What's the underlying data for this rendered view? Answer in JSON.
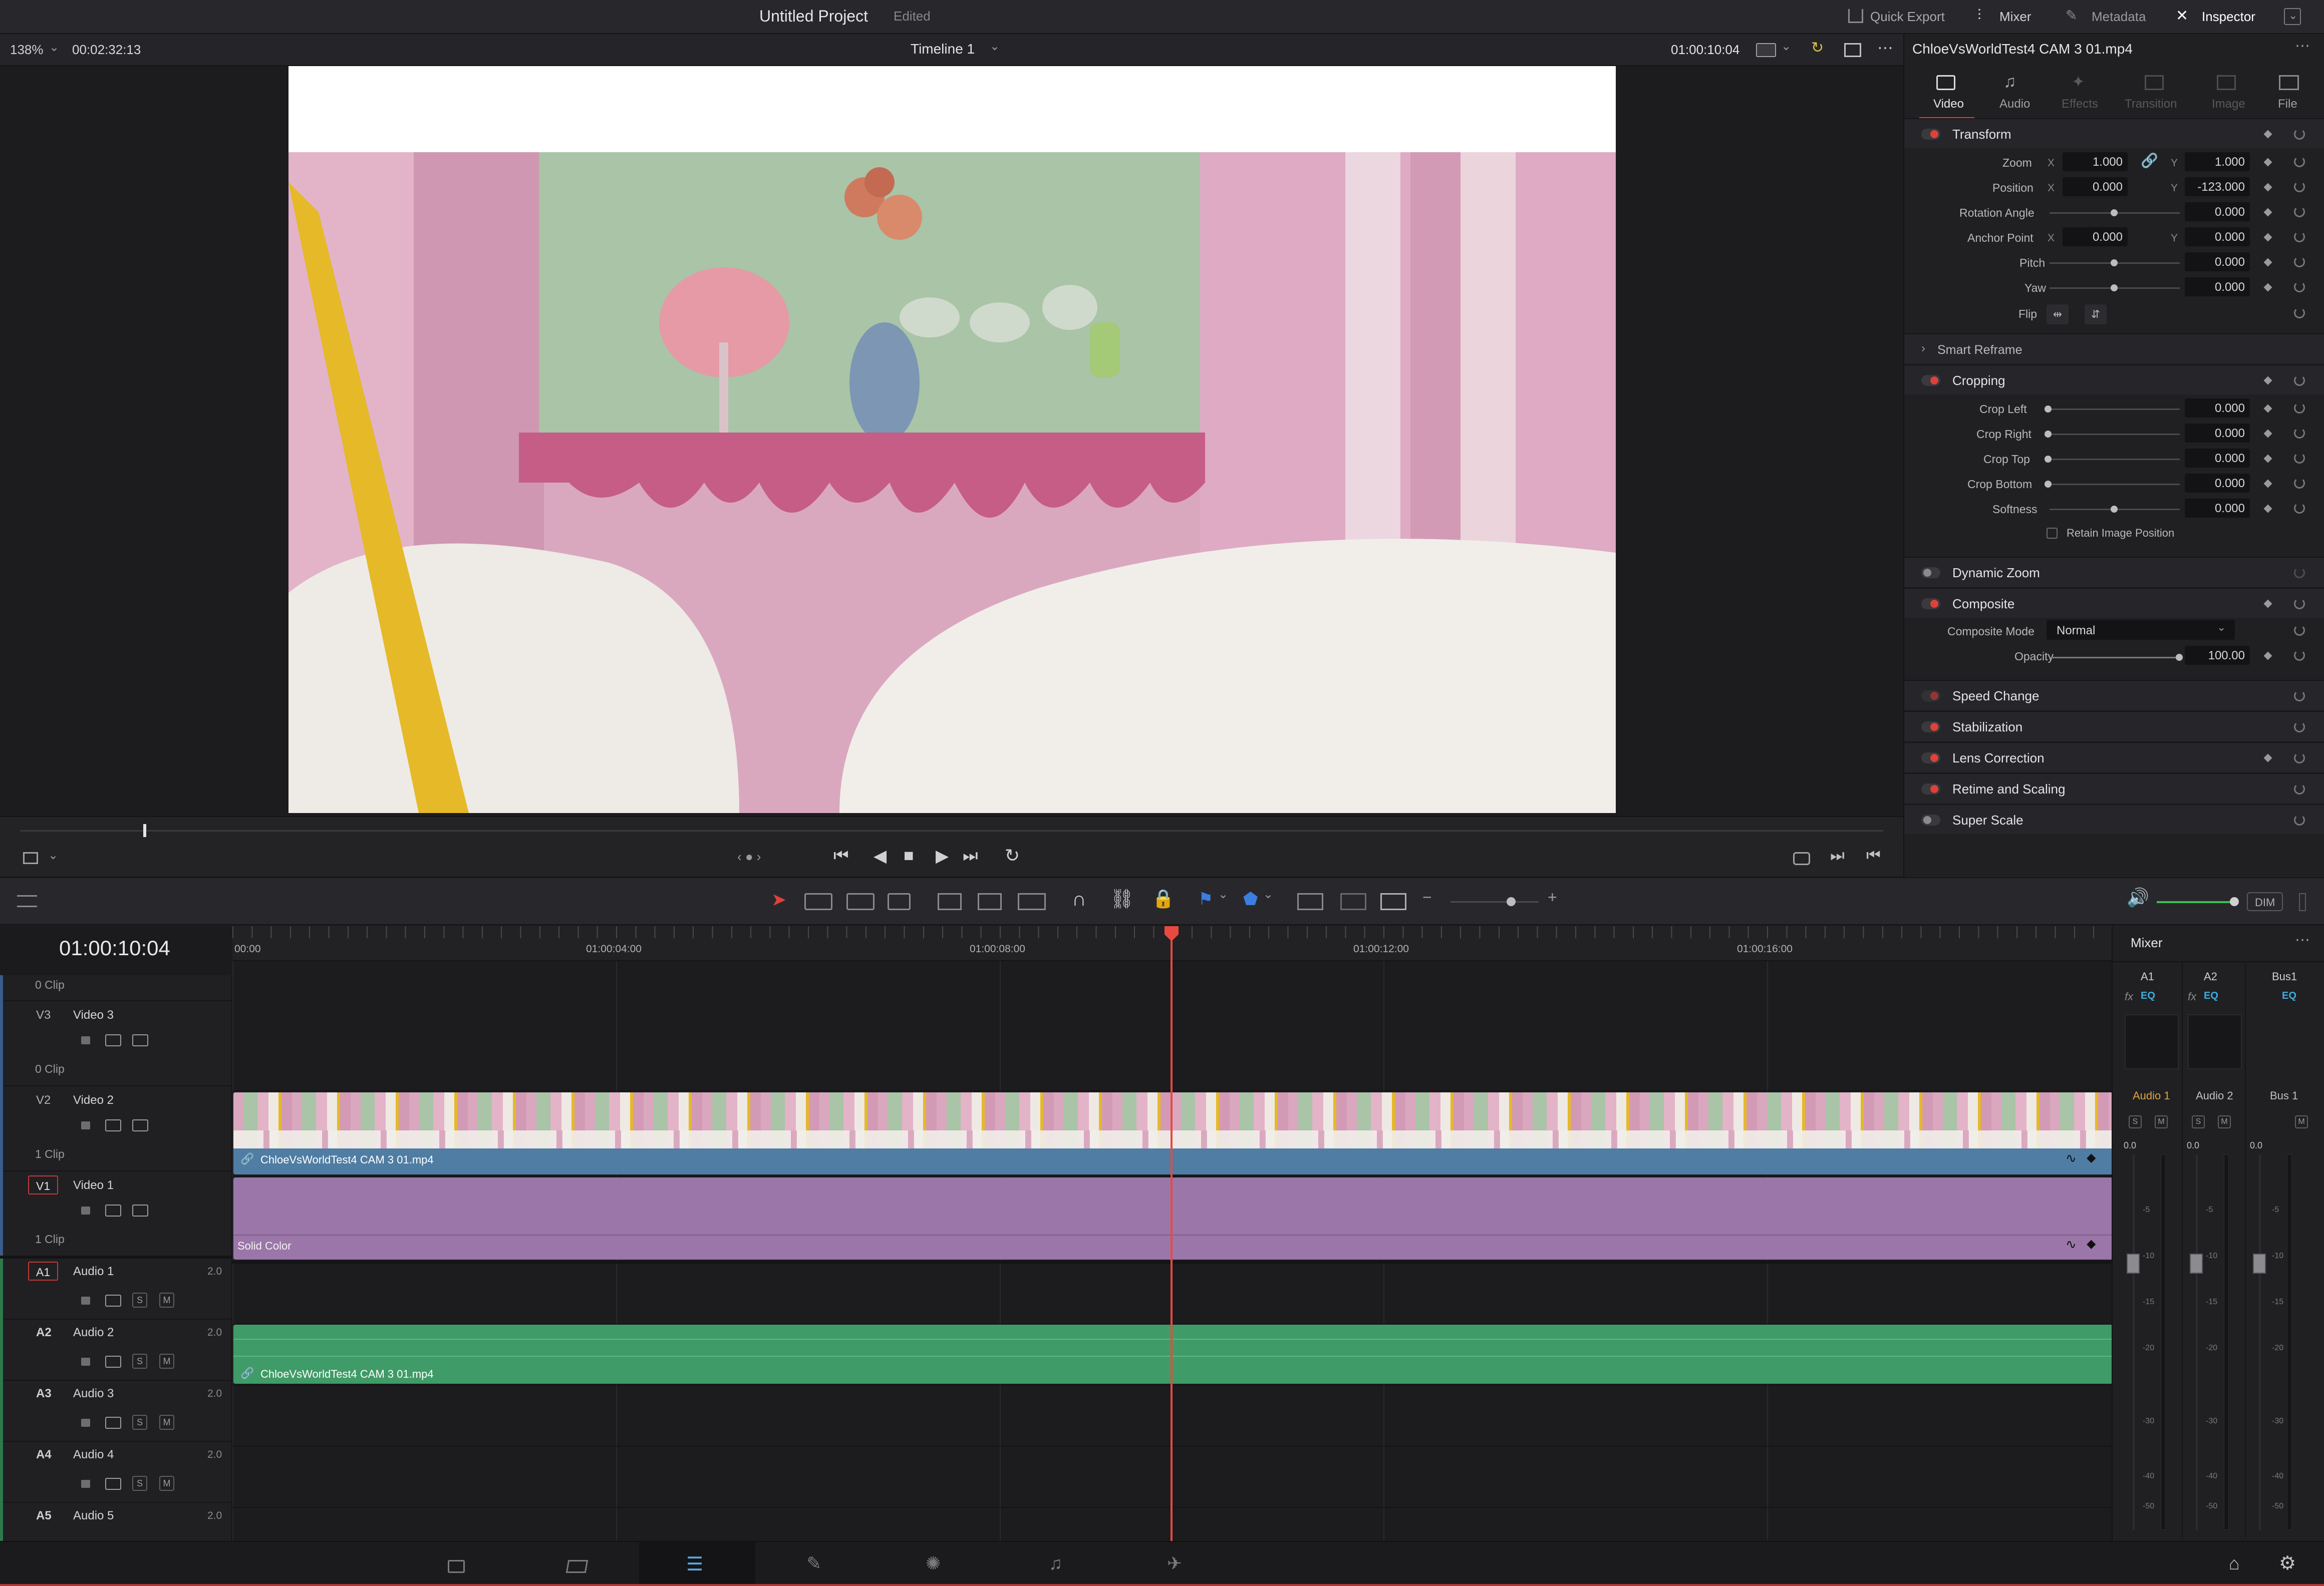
{
  "project": {
    "title": "Untitled Project",
    "status": "Edited"
  },
  "top_tabs": [
    "Quick Export",
    "Mixer",
    "Metadata",
    "Inspector"
  ],
  "viewer": {
    "zoom": "138%",
    "source_timecode": "00:02:32:13",
    "timeline_name": "Timeline 1",
    "record_timecode": "01:00:10:04"
  },
  "inspector": {
    "clip_name": "ChloeVsWorldTest4 CAM 3 01.mp4",
    "tabs": [
      "Video",
      "Audio",
      "Effects",
      "Transition",
      "Image",
      "File"
    ],
    "transform": {
      "title": "Transform",
      "zoom_label": "Zoom",
      "zoom_x": "1.000",
      "zoom_y": "1.000",
      "position_label": "Position",
      "position_x": "0.000",
      "position_y": "-123.000",
      "rotation_label": "Rotation Angle",
      "rotation": "0.000",
      "anchor_label": "Anchor Point",
      "anchor_x": "0.000",
      "anchor_y": "0.000",
      "pitch_label": "Pitch",
      "pitch": "0.000",
      "yaw_label": "Yaw",
      "yaw": "0.000",
      "flip_label": "Flip",
      "x_label": "X",
      "y_label": "Y"
    },
    "smart_reframe": "Smart Reframe",
    "cropping": {
      "title": "Cropping",
      "crop_left_label": "Crop Left",
      "crop_left": "0.000",
      "crop_right_label": "Crop Right",
      "crop_right": "0.000",
      "crop_top_label": "Crop Top",
      "crop_top": "0.000",
      "crop_bottom_label": "Crop Bottom",
      "crop_bottom": "0.000",
      "softness_label": "Softness",
      "softness": "0.000",
      "retain_label": "Retain Image Position"
    },
    "dynamic_zoom": "Dynamic Zoom",
    "composite": {
      "title": "Composite",
      "mode_label": "Composite Mode",
      "mode": "Normal",
      "opacity_label": "Opacity",
      "opacity": "100.00"
    },
    "speed_change": "Speed Change",
    "stabilization": "Stabilization",
    "lens_correction": "Lens Correction",
    "retime": "Retime and Scaling",
    "super_scale": "Super Scale"
  },
  "timeline": {
    "timecode": "01:00:10:04",
    "ruler": [
      "00:00",
      "01:00:04:00",
      "01:00:08:00",
      "01:00:12:00",
      "01:00:16:00"
    ],
    "top_clip_count": "0 Clip",
    "tracks": {
      "v3": {
        "code": "V3",
        "name": "Video 3",
        "clips": "0 Clip"
      },
      "v2": {
        "code": "V2",
        "name": "Video 2",
        "clips": "1 Clip"
      },
      "v1": {
        "code": "V1",
        "name": "Video 1",
        "clips": "1 Clip"
      },
      "a1": {
        "code": "A1",
        "name": "Audio 1",
        "ch": "2.0"
      },
      "a2": {
        "code": "A2",
        "name": "Audio 2",
        "ch": "2.0"
      },
      "a3": {
        "code": "A3",
        "name": "Audio 3",
        "ch": "2.0"
      },
      "a4": {
        "code": "A4",
        "name": "Audio 4",
        "ch": "2.0"
      },
      "a5": {
        "code": "A5",
        "name": "Audio 5",
        "ch": "2.0"
      }
    },
    "clips": {
      "v2_clip": "ChloeVsWorldTest4 CAM 3 01.mp4",
      "v1_clip": "Solid Color",
      "a2_clip": "ChloeVsWorldTest4 CAM 3 01.mp4"
    },
    "solo": "S",
    "mute": "M",
    "dim": "DIM"
  },
  "mixer": {
    "title": "Mixer",
    "channels": [
      "A1",
      "A2",
      "Bus1"
    ],
    "channel_names": [
      "Audio 1",
      "Audio 2",
      "Bus 1"
    ],
    "fx": "fx",
    "eq": "EQ",
    "levels": [
      "0.0",
      "0.0",
      "0.0"
    ],
    "scale": [
      "-5",
      "-10",
      "-15",
      "-20",
      "-30",
      "-40",
      "-50"
    ]
  },
  "colors": {
    "accent_red": "#e0403a",
    "video_clip": "#4f7da3",
    "solid_color": "#9b76a8",
    "audio_clip": "#3f9b67",
    "playhead": "#e84a3f"
  }
}
